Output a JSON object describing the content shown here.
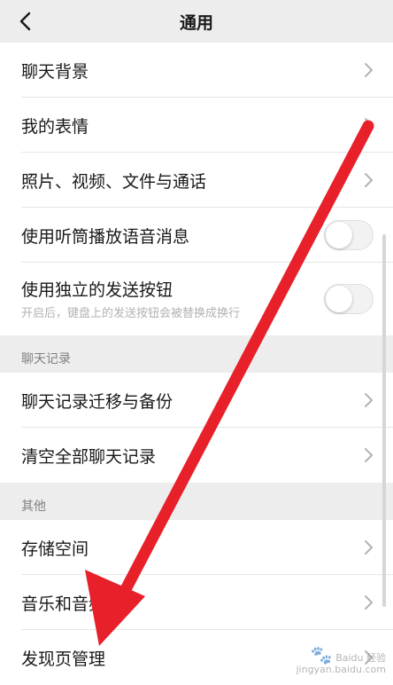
{
  "header": {
    "title": "通用"
  },
  "rows_top": [
    {
      "label": "聊天背景"
    },
    {
      "label": "我的表情"
    },
    {
      "label": "照片、视频、文件与通话"
    }
  ],
  "toggles": [
    {
      "label": "使用听筒播放语音消息",
      "on": false
    },
    {
      "label": "使用独立的发送按钮",
      "sub": "开启后，键盘上的发送按钮会被替换成换行",
      "on": false
    }
  ],
  "section_chat": {
    "title": "聊天记录",
    "items": [
      {
        "label": "聊天记录迁移与备份"
      },
      {
        "label": "清空全部聊天记录"
      }
    ]
  },
  "section_other": {
    "title": "其他",
    "items": [
      {
        "label": "存储空间"
      },
      {
        "label": "音乐和音频"
      },
      {
        "label": "发现页管理"
      }
    ]
  },
  "watermark": {
    "line1": "Baidu 经验",
    "line2": "jingyan.baidu.com"
  },
  "colors": {
    "arrow": "#e8202a",
    "background": "#ededed",
    "cell": "#ffffff"
  },
  "icons": {
    "back": "chevron-left-icon",
    "row": "chevron-right-icon"
  }
}
